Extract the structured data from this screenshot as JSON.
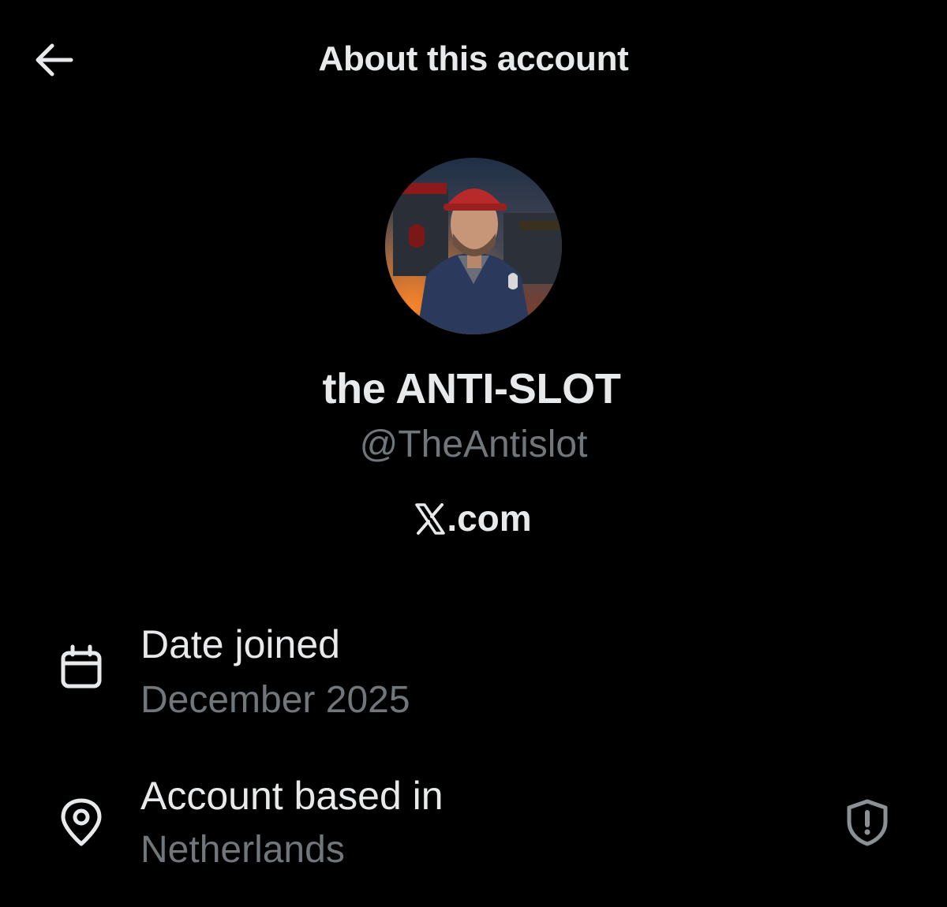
{
  "header": {
    "back_icon": "arrow-left-icon",
    "title": "About this account"
  },
  "profile": {
    "avatar_icon": "profile-avatar-image",
    "display_name": "the ANTI-SLOT",
    "handle": "@TheAntislot",
    "platform_logo": "x-logo-icon",
    "platform_text": ".com"
  },
  "info": {
    "date_joined": {
      "icon": "calendar-icon",
      "label": "Date joined",
      "value": "December 2025"
    },
    "account_based_in": {
      "icon": "location-pin-icon",
      "label": "Account based in",
      "value": "Netherlands",
      "trailing_icon": "shield-alert-icon"
    }
  },
  "colors": {
    "background": "#000000",
    "primary_text": "#e7e9ea",
    "secondary_text": "#71767b"
  }
}
